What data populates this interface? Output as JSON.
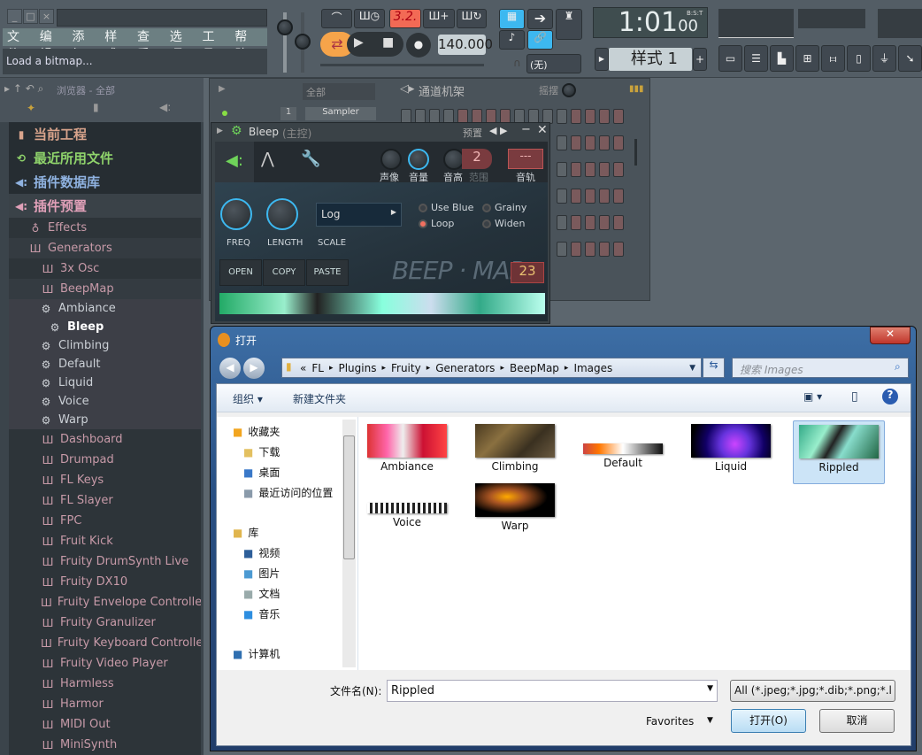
{
  "menu": [
    "文件",
    "编辑",
    "添加",
    "样式",
    "查看",
    "选项",
    "工具",
    "帮助"
  ],
  "hint": "Load a bitmap...",
  "transport": {
    "pattern_song_label": "3.2.",
    "tempo": "140.000",
    "snap": "(无)",
    "time": "1:01",
    "time_sub": "00",
    "time_format": "B:S:T",
    "pattern": "样式 1",
    "pattern_add": "+"
  },
  "browser": {
    "title": "浏览器 - 全部",
    "items": [
      {
        "label": "当前工程",
        "kind": "top",
        "color": "#d9a48c",
        "icon": "file-icon"
      },
      {
        "label": "最近所用文件",
        "kind": "top",
        "color": "#8fd36b",
        "icon": "recent-icon"
      },
      {
        "label": "插件数据库",
        "kind": "top",
        "color": "#8fb2e0",
        "icon": "plugin-icon"
      },
      {
        "label": "插件预置",
        "kind": "top sel",
        "color": "#e0a0b8",
        "icon": "plugin-icon"
      },
      {
        "label": "Effects",
        "kind": "cat",
        "indent": 22,
        "icon": "effects-icon"
      },
      {
        "label": "Generators",
        "kind": "gen",
        "indent": 22,
        "icon": "piano-icon"
      },
      {
        "label": "3x Osc",
        "kind": "cat",
        "indent": 36,
        "icon": "piano-icon"
      },
      {
        "label": "BeepMap",
        "kind": "gen",
        "indent": 36,
        "icon": "piano-icon"
      },
      {
        "label": "Ambiance",
        "kind": "pre",
        "indent": 34,
        "icon": "gear-icon"
      },
      {
        "label": "Bleep",
        "kind": "pre",
        "indent": 44,
        "icon": "gear-icon",
        "active": true
      },
      {
        "label": "Climbing",
        "kind": "pre",
        "indent": 34,
        "icon": "gear-icon"
      },
      {
        "label": "Default",
        "kind": "pre",
        "indent": 34,
        "icon": "gear-icon"
      },
      {
        "label": "Liquid",
        "kind": "pre",
        "indent": 34,
        "icon": "gear-icon"
      },
      {
        "label": "Voice",
        "kind": "pre",
        "indent": 34,
        "icon": "gear-icon"
      },
      {
        "label": "Warp",
        "kind": "pre",
        "indent": 34,
        "icon": "gear-icon"
      },
      {
        "label": "Dashboard",
        "kind": "cat",
        "indent": 36,
        "icon": "piano-icon"
      },
      {
        "label": "Drumpad",
        "kind": "cat",
        "indent": 36,
        "icon": "piano-icon"
      },
      {
        "label": "FL Keys",
        "kind": "cat",
        "indent": 36,
        "icon": "piano-icon"
      },
      {
        "label": "FL Slayer",
        "kind": "cat",
        "indent": 36,
        "icon": "piano-icon"
      },
      {
        "label": "FPC",
        "kind": "cat",
        "indent": 36,
        "icon": "piano-icon"
      },
      {
        "label": "Fruit Kick",
        "kind": "cat",
        "indent": 36,
        "icon": "piano-icon"
      },
      {
        "label": "Fruity DrumSynth Live",
        "kind": "cat",
        "indent": 36,
        "icon": "piano-icon"
      },
      {
        "label": "Fruity DX10",
        "kind": "cat",
        "indent": 36,
        "icon": "piano-icon"
      },
      {
        "label": "Fruity Envelope Controller",
        "kind": "cat",
        "indent": 36,
        "icon": "piano-icon"
      },
      {
        "label": "Fruity Granulizer",
        "kind": "cat",
        "indent": 36,
        "icon": "piano-icon"
      },
      {
        "label": "Fruity Keyboard Controller",
        "kind": "cat",
        "indent": 36,
        "icon": "piano-icon"
      },
      {
        "label": "Fruity Video Player",
        "kind": "cat",
        "indent": 36,
        "icon": "piano-icon"
      },
      {
        "label": "Harmless",
        "kind": "cat",
        "indent": 36,
        "icon": "piano-icon"
      },
      {
        "label": "Harmor",
        "kind": "cat",
        "indent": 36,
        "icon": "piano-icon"
      },
      {
        "label": "MIDI Out",
        "kind": "cat",
        "indent": 36,
        "icon": "piano-icon"
      },
      {
        "label": "MiniSynth",
        "kind": "cat",
        "indent": 36,
        "icon": "piano-icon"
      }
    ]
  },
  "rack": {
    "filter": "全部",
    "title": "通道机架",
    "swing_label": "摇摆",
    "channel_number": "1",
    "channel_name": "Sampler"
  },
  "plugin": {
    "title": "Bleep",
    "title_suffix": "(主控)",
    "presets_label": "预置",
    "knobs": {
      "pan": "声像",
      "volume": "音量",
      "pitch": "音高",
      "range": "范围",
      "track": "音轨"
    },
    "range_value": "2",
    "track_value": "---",
    "freq": "FREQ",
    "length": "LENGTH",
    "scale_label": "SCALE",
    "scale_value": "Log",
    "options": [
      {
        "label": "Use Blue",
        "on": false
      },
      {
        "label": "Loop",
        "on": true
      },
      {
        "label": "Grainy",
        "on": false
      },
      {
        "label": "Widen",
        "on": false
      }
    ],
    "buttons": [
      "OPEN",
      "COPY",
      "PASTE"
    ],
    "logo": "BEEP · MAP",
    "number": "23"
  },
  "dialog": {
    "title": "打开",
    "path": [
      "«",
      "FL",
      "Plugins",
      "Fruity",
      "Generators",
      "BeepMap",
      "Images"
    ],
    "search_placeholder": "搜索 Images",
    "organize": "组织 ▾",
    "new_folder": "新建文件夹",
    "nav": [
      {
        "label": "收藏夹",
        "icon": "star-icon",
        "color": "#f2a51f",
        "lvl": 0
      },
      {
        "label": "下载",
        "icon": "download-folder-icon",
        "color": "#e3c060",
        "lvl": 1
      },
      {
        "label": "桌面",
        "icon": "desktop-icon",
        "color": "#3a78c8",
        "lvl": 1
      },
      {
        "label": "最近访问的位置",
        "icon": "recent-places-icon",
        "color": "#8a9aaa",
        "lvl": 1
      },
      {
        "label": "库",
        "icon": "library-icon",
        "color": "#e0b54e",
        "lvl": 0,
        "gap": true
      },
      {
        "label": "视频",
        "icon": "video-icon",
        "color": "#2d5e99",
        "lvl": 1
      },
      {
        "label": "图片",
        "icon": "pictures-icon",
        "color": "#4c9ad2",
        "lvl": 1
      },
      {
        "label": "文档",
        "icon": "documents-icon",
        "color": "#9aa",
        "lvl": 1
      },
      {
        "label": "音乐",
        "icon": "music-icon",
        "color": "#2d8ee0",
        "lvl": 1
      },
      {
        "label": "计算机",
        "icon": "computer-icon",
        "color": "#2f6fb0",
        "lvl": 0,
        "gap": true
      }
    ],
    "files": [
      {
        "name": "Ambiance",
        "bg": "linear-gradient(90deg,#d33 0%,#f6a 25%,#eee 45%,#c13 70%,#f44 100%)"
      },
      {
        "name": "Climbing",
        "bg": "linear-gradient(135deg,#4a3a20,#8a7040,#3a3020,#6a5a40)"
      },
      {
        "name": "Default",
        "bg": "linear-gradient(90deg,#c44 0%,#f70 20%,#fff 50%,#111 100%)",
        "thin": true
      },
      {
        "name": "Liquid",
        "bg": "radial-gradient(circle at 55% 60%,#c4f 0%,#63d 30%,#106 60%,#000 90%)"
      },
      {
        "name": "Rippled",
        "bg": "linear-gradient(120deg,#3a8 0%,#9ec 30%,#222 45%,#8dc 60%,#264 100%)",
        "selected": true
      },
      {
        "name": "Voice",
        "bg": "repeating-linear-gradient(90deg,#fff 0 3px,#222 3px 6px)",
        "thin": true
      },
      {
        "name": "Warp",
        "bg": "radial-gradient(ellipse at 40% 40%,#fa0 0%,#a52 25%,#000 60%)"
      }
    ],
    "filename_label": "文件名(N):",
    "filename": "Rippled",
    "filetype": "All (*.jpeg;*.jpg;*.dib;*.png;*.l",
    "favorites": "Favorites",
    "open": "打开(O)",
    "cancel": "取消"
  }
}
